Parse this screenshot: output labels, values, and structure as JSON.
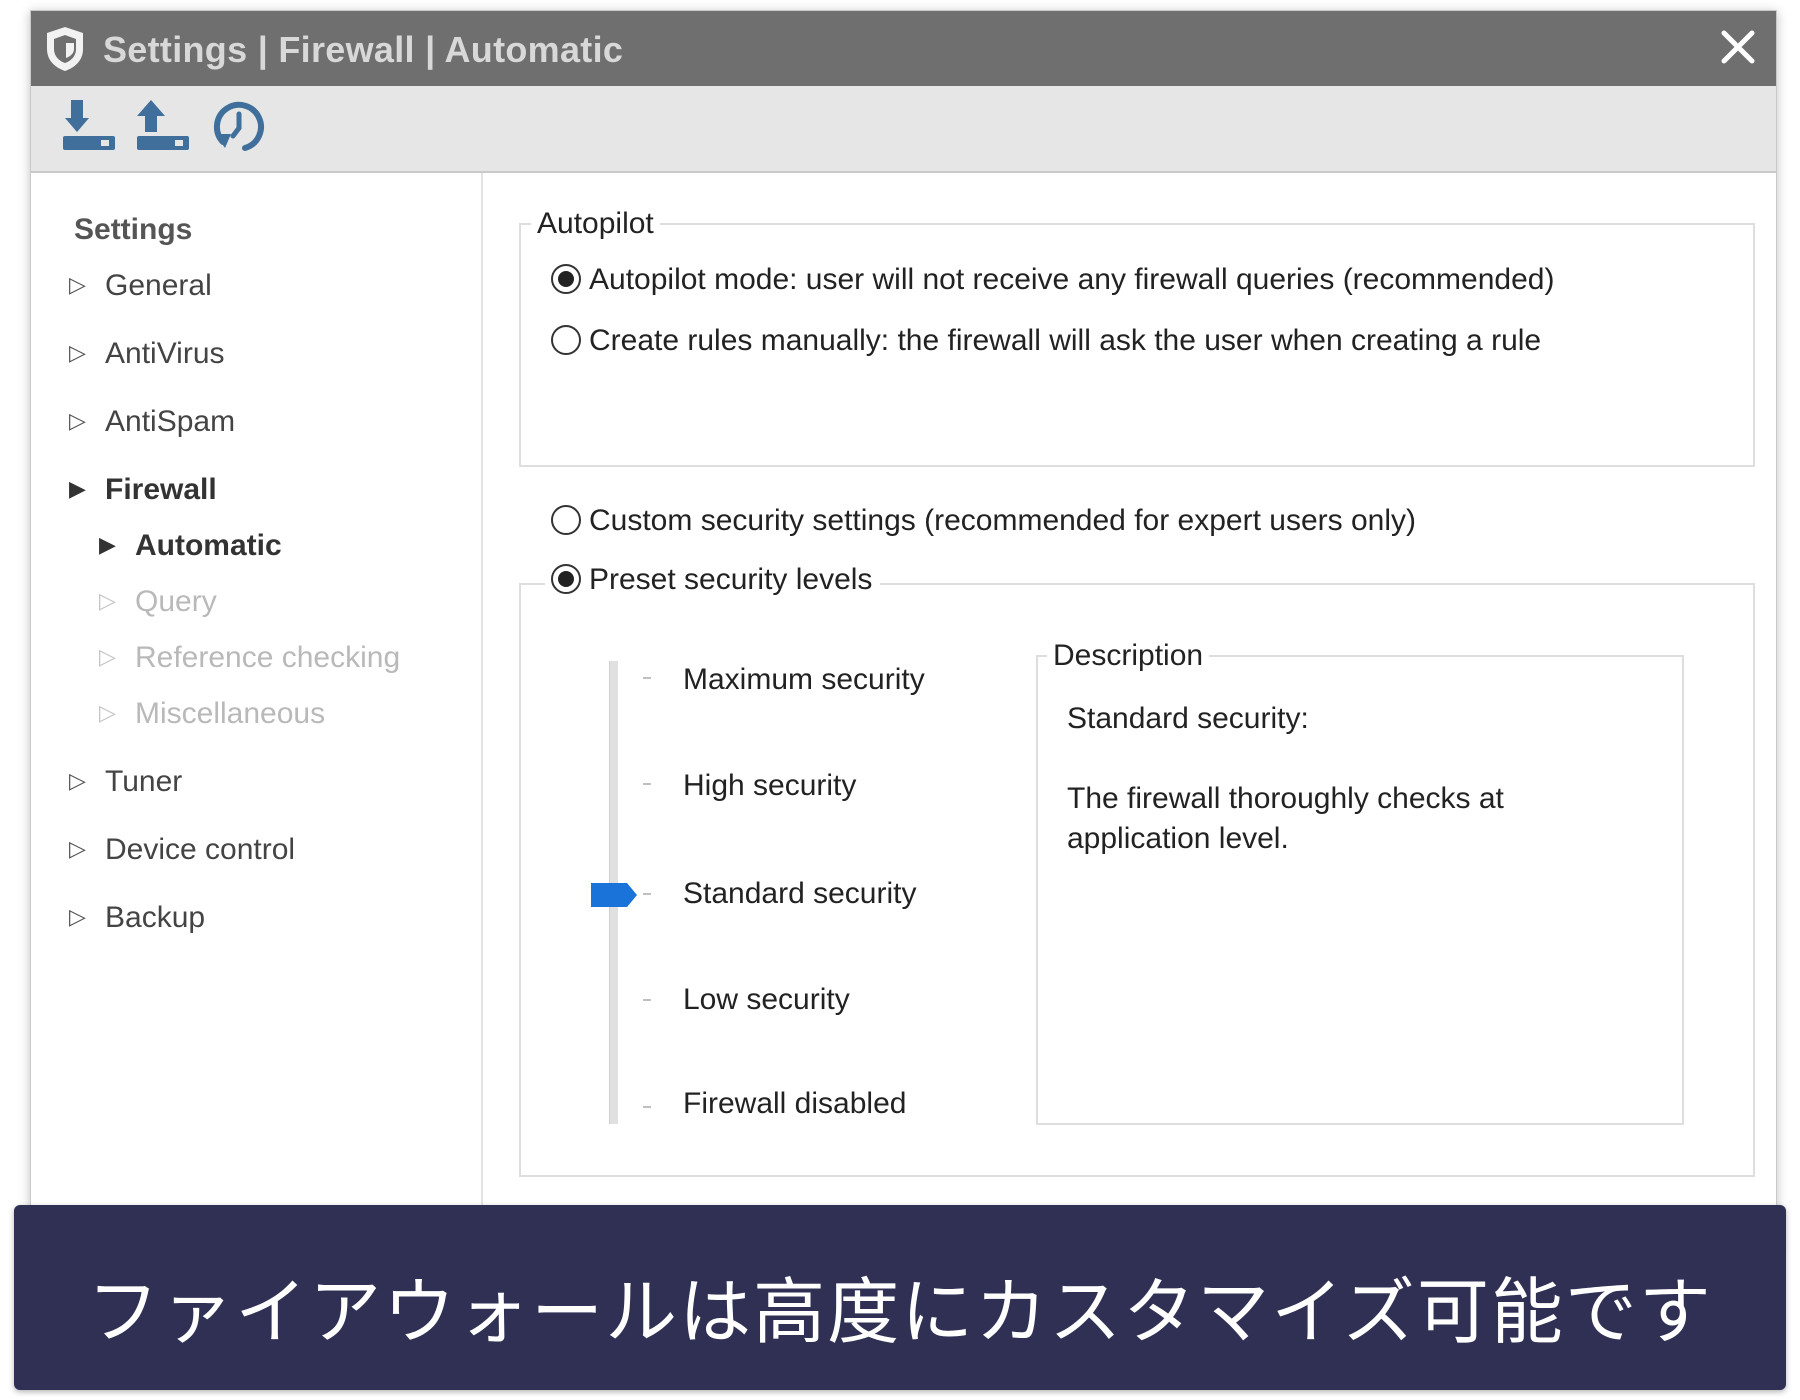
{
  "window": {
    "title": "Settings | Firewall | Automatic",
    "toolbar": [
      "download-icon",
      "upload-icon",
      "restore-icon"
    ]
  },
  "sidebar": {
    "heading": "Settings",
    "items": [
      {
        "label": "General",
        "state": "normal"
      },
      {
        "label": "AntiVirus",
        "state": "normal"
      },
      {
        "label": "AntiSpam",
        "state": "normal"
      },
      {
        "label": "Firewall",
        "state": "expanded"
      },
      {
        "label": "Automatic",
        "state": "selected"
      },
      {
        "label": "Query",
        "state": "disabled"
      },
      {
        "label": "Reference checking",
        "state": "disabled"
      },
      {
        "label": "Miscellaneous",
        "state": "disabled"
      },
      {
        "label": "Tuner",
        "state": "normal"
      },
      {
        "label": "Device control",
        "state": "normal"
      },
      {
        "label": "Backup",
        "state": "normal"
      }
    ]
  },
  "autopilot": {
    "legend": "Autopilot",
    "option_auto": "Autopilot mode: user will not receive any firewall queries (recommended)",
    "option_manual": "Create rules manually: the firewall will ask the user when creating a rule",
    "selected": "auto"
  },
  "security": {
    "option_custom": "Custom security settings (recommended for expert users only)",
    "option_preset": "Preset security levels",
    "selected": "preset",
    "levels": [
      "Maximum security",
      "High security",
      "Standard security",
      "Low security",
      "Firewall disabled"
    ],
    "current_level": "Standard security",
    "accent_color": "#1a73d9"
  },
  "description": {
    "legend": "Description",
    "title": "Standard security:",
    "body": "The firewall thoroughly checks at application level."
  },
  "banner": {
    "text": "ファイアウォールは高度にカスタマイズ可能です",
    "background": "#2f3054"
  }
}
